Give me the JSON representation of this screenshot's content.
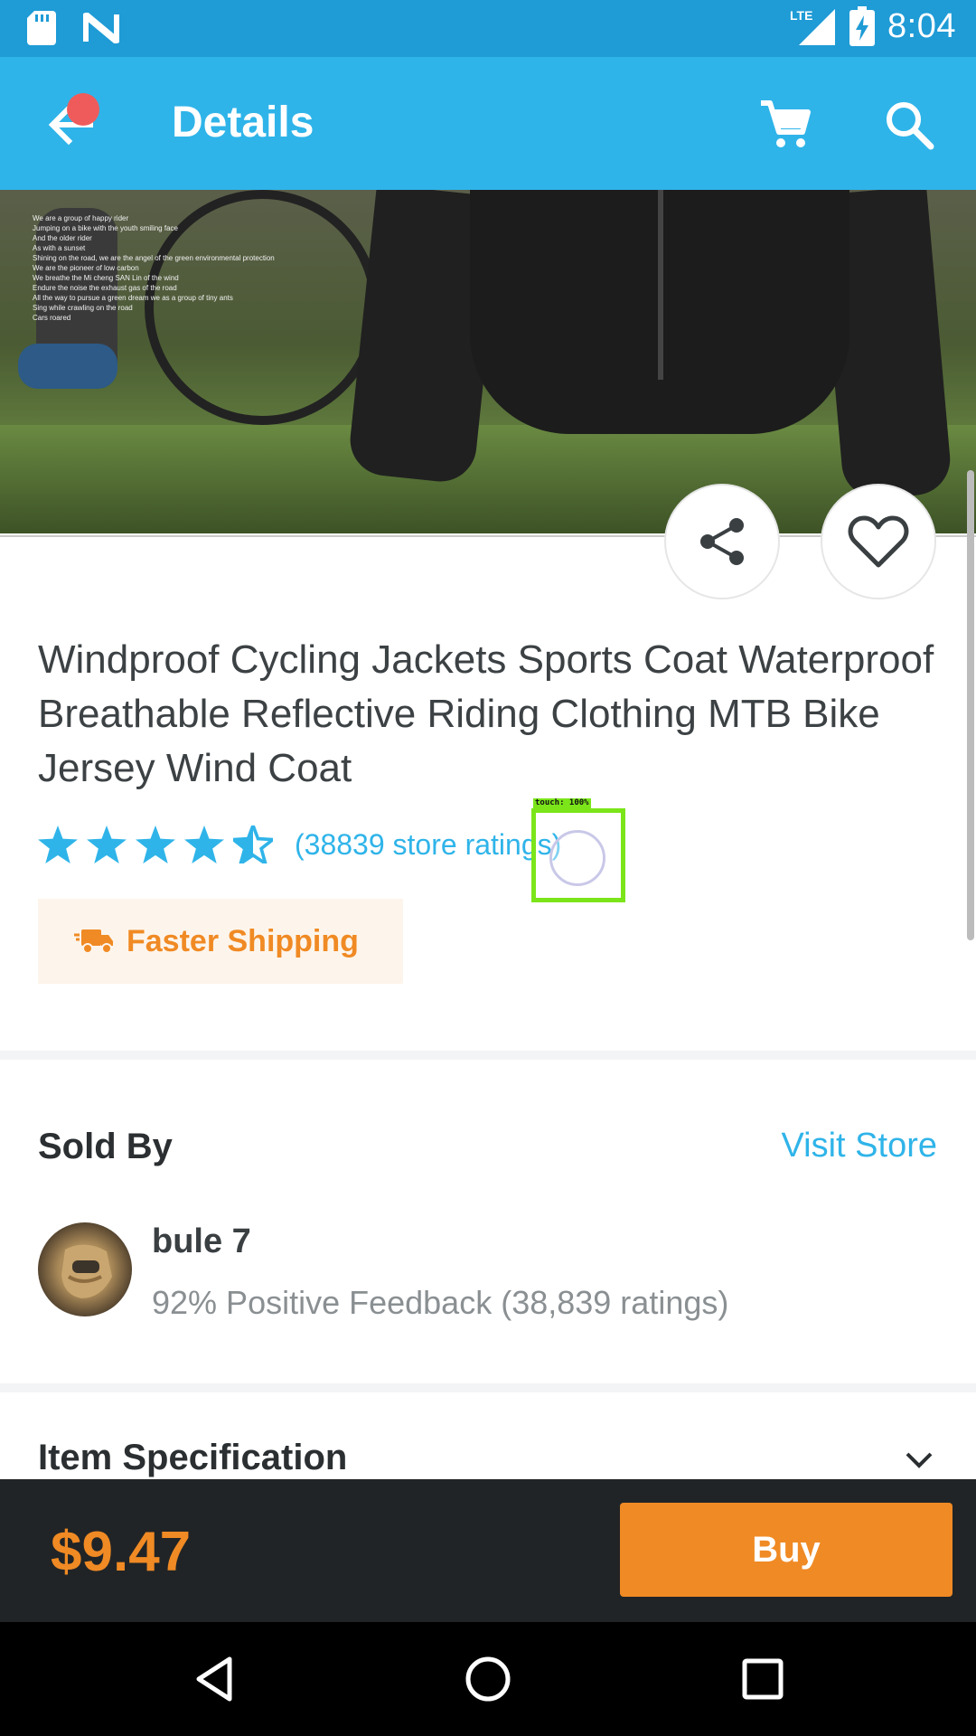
{
  "status_bar": {
    "time": "8:04",
    "network": "LTE",
    "icons": [
      "sd-card-icon",
      "n-logo-icon",
      "lte-signal-icon",
      "battery-charging-icon"
    ]
  },
  "app_bar": {
    "title": "Details",
    "icons": [
      "back-arrow-icon",
      "cart-icon",
      "search-icon"
    ],
    "colors": {
      "background": "#2fb4e9",
      "status_bar": "#1f9bd6",
      "notification_dot": "#ef5b5b"
    }
  },
  "product": {
    "image_caption_lines": [
      "We are a group of happy rider",
      "Jumping on a bike with the youth smiling face",
      "And the older rider",
      "As with a sunset",
      "Shining on the road, we are the angel of the green environmental protection",
      "We are the pioneer of low carbon",
      "We breathe the Mi cheng SAN Lin of the wind",
      "Endure the noise the exhaust gas of the road",
      "All the way to pursue a green dream we as a group of tiny ants",
      "Sing while crawling on the road",
      "Cars roared"
    ],
    "title": "Windproof Cycling Jackets Sports Coat Waterproof Breathable Reflective Riding Clothing MTB Bike Jersey Wind Coat",
    "rating": 4.5,
    "rating_count_text": "(38839 store ratings)",
    "badge_text": "Faster Shipping",
    "touch_label": "touch: 100%",
    "colors": {
      "accent": "#2fb4e9",
      "star": "#2fb4e9",
      "badge_text": "#f08a24",
      "badge_bg": "#fdf5ec"
    }
  },
  "seller": {
    "section_title": "Sold By",
    "visit_store_label": "Visit Store",
    "name": "bule 7",
    "feedback": "92% Positive Feedback (38,839 ratings)"
  },
  "spec": {
    "title": "Item Specification"
  },
  "buy_bar": {
    "price": "$9.47",
    "buy_label": "Buy",
    "colors": {
      "background": "#212426",
      "price": "#f08a24",
      "button": "#f08a24"
    }
  },
  "nav_bar": {
    "icons": [
      "nav-back-icon",
      "nav-home-icon",
      "nav-recents-icon"
    ]
  }
}
